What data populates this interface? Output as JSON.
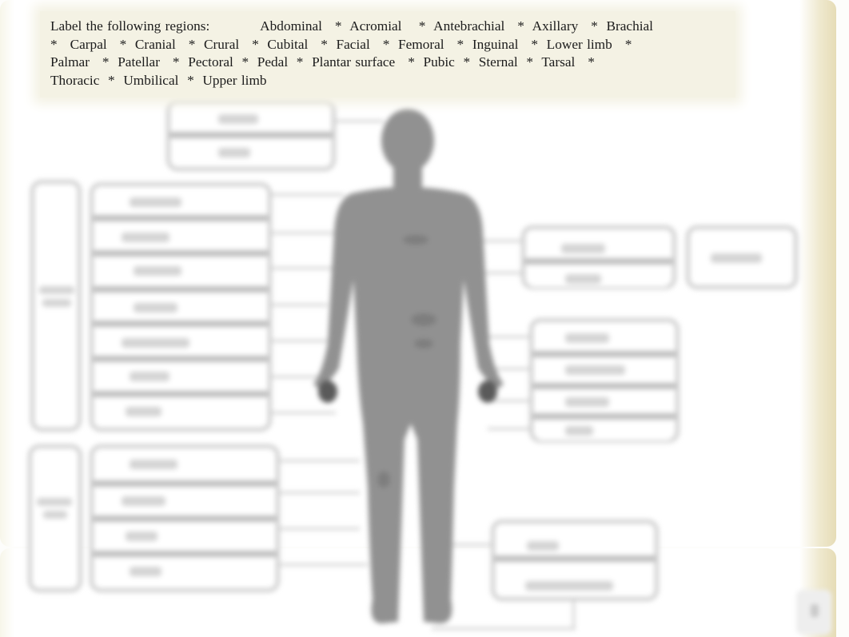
{
  "worksheet": {
    "instruction_prefix": "Label the following regions:",
    "terms": [
      "Abdominal",
      "Acromial",
      "Antebrachial",
      "Axillary",
      "Brachial",
      "Carpal",
      "Cranial",
      "Crural",
      "Cubital",
      "Facial",
      "Femoral",
      "Inguinal",
      "Lower limb",
      "Palmar",
      "Patellar",
      "Pectoral",
      "Pedal",
      "Plantar surface",
      "Pubic",
      "Sternal",
      "Tarsal",
      "Thoracic",
      "Umbilical",
      "Upper limb"
    ],
    "separator": "*",
    "instruction_lines": [
      "Label the following regions:            Abdominal   *  Acromial    *  Antebrachial   *  Axillary   *  Brachial",
      "*   Carpal   *  Cranial   *  Crural   *  Cubital   *  Facial   *  Femoral   *  Inguinal   *  Lower limb   *",
      "Palmar   *  Patellar   *  Pectoral  *  Pedal  *  Plantar surface   *  Pubic  *  Sternal  *  Tarsal   *",
      "Thoracic  *  Umbilical  *  Upper limb"
    ]
  },
  "diagram": {
    "figure": "anterior human body silhouette",
    "label_boxes": {
      "head_group": 2,
      "left_upper_group": 7,
      "left_lower_group": 4,
      "right_arm_group": 2,
      "right_group_extra": 1,
      "right_mid_group": 4,
      "bottom_right_group": 2
    }
  },
  "colors": {
    "instruction_bg": "#f4f2e4",
    "silhouette": "#8f8f8f",
    "box_border": "#cfcfcf",
    "page_edge": "#e6dcb6"
  }
}
